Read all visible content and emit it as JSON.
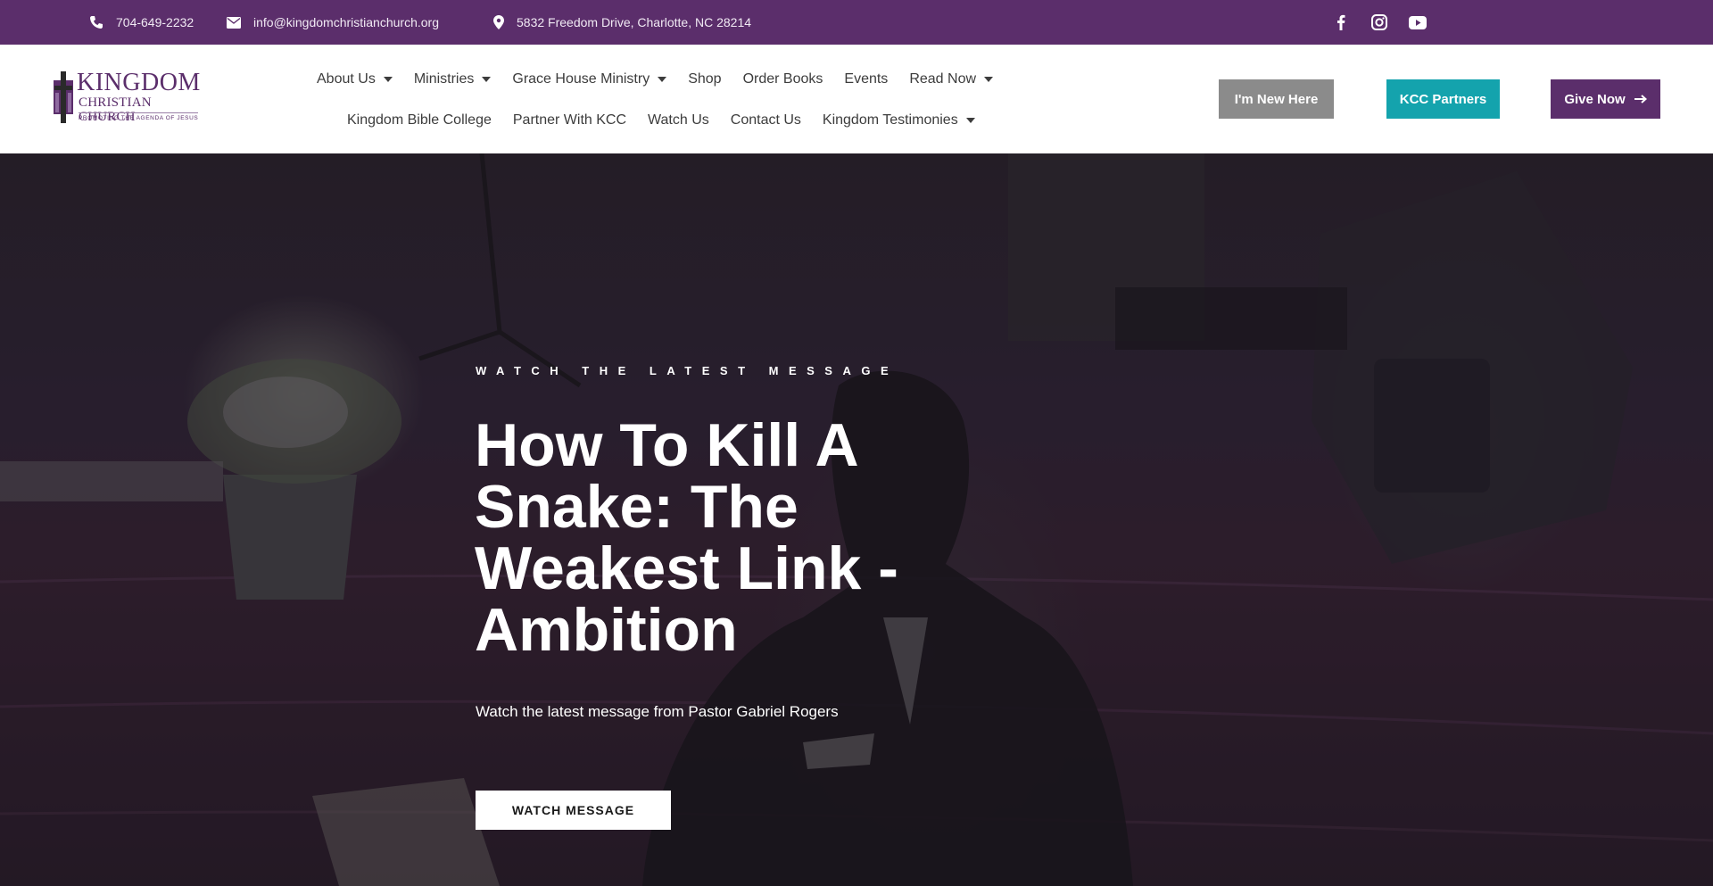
{
  "topbar": {
    "phone": "704-649-2232",
    "email": "info@kingdomchristianchurch.org",
    "address": "5832 Freedom Drive, Charlotte, NC 28214",
    "social": [
      "facebook-icon",
      "instagram-icon",
      "youtube-icon"
    ]
  },
  "logo": {
    "title": "KINGDOM",
    "subtitle": "CHRISTIAN CHURCH",
    "tagline": "PROMOTING THE AGENDA OF JESUS CHRIST"
  },
  "nav": {
    "row1": [
      {
        "label": "About Us",
        "dropdown": true
      },
      {
        "label": "Ministries",
        "dropdown": true
      },
      {
        "label": "Grace House Ministry",
        "dropdown": true
      },
      {
        "label": "Shop",
        "dropdown": false
      },
      {
        "label": "Order Books",
        "dropdown": false
      },
      {
        "label": "Events",
        "dropdown": false
      },
      {
        "label": "Read Now",
        "dropdown": true
      }
    ],
    "row2": [
      {
        "label": "Kingdom Bible College",
        "dropdown": false
      },
      {
        "label": "Partner With KCC",
        "dropdown": false
      },
      {
        "label": "Watch Us",
        "dropdown": false
      },
      {
        "label": "Contact Us",
        "dropdown": false
      },
      {
        "label": "Kingdom Testimonies",
        "dropdown": true
      }
    ]
  },
  "header_buttons": {
    "new_here": "I'm New Here",
    "partners": "KCC Partners",
    "give": "Give Now",
    "give_icon": "arrow-right-icon"
  },
  "hero": {
    "eyebrow": "WATCH THE LATEST MESSAGE",
    "title": "How To Kill A Snake: The Weakest Link - Ambition",
    "subtitle": "Watch the latest message from Pastor Gabriel Rogers",
    "button": "WATCH MESSAGE"
  },
  "colors": {
    "brand_purple": "#5b2e6b",
    "teal": "#14a3ad",
    "gray_button": "#8b8b8b"
  }
}
